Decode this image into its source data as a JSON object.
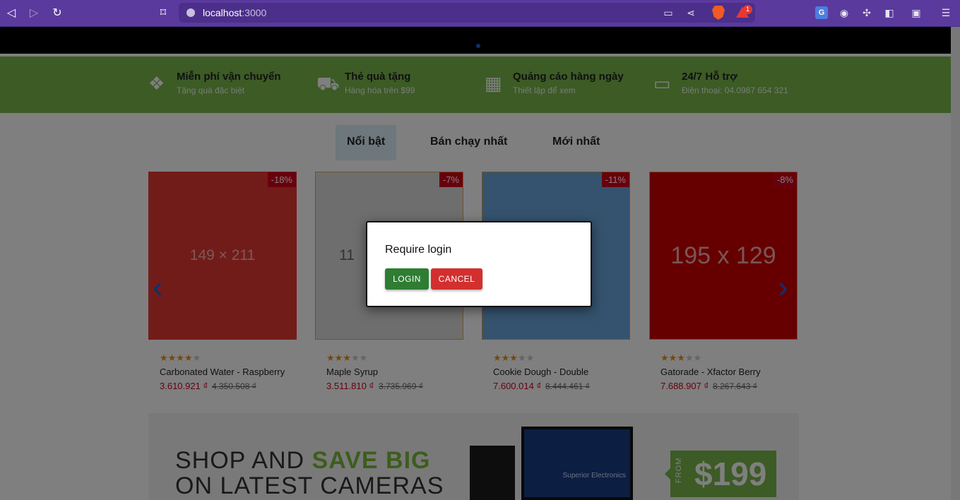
{
  "browser": {
    "url_host": "localhost",
    "url_port": ":3000",
    "rewards_badge": "1"
  },
  "features": [
    {
      "icon": "dropbox-icon",
      "title": "Miễn phí vận chuyển",
      "subtitle": "Tặng quà đặc biệt"
    },
    {
      "icon": "truck-icon",
      "title": "Thẻ quà tặng",
      "subtitle": "Hàng hóa trên $99"
    },
    {
      "icon": "calendar-icon",
      "title": "Quảng cáo hàng ngày",
      "subtitle": "Thiết lập để xem"
    },
    {
      "icon": "chat-icon",
      "title": "24/7 Hỗ trợ",
      "subtitle": "Điện thoại: 04.0987 654 321"
    }
  ],
  "tabs": [
    {
      "label": "Nổi bật",
      "active": true
    },
    {
      "label": "Bán chạy nhất",
      "active": false
    },
    {
      "label": "Mới nhất",
      "active": false
    }
  ],
  "products": [
    {
      "image_text": "149 × 211",
      "image_color": "#e53935",
      "discount": "-18%",
      "rating": 4,
      "name": "Carbonated Water - Raspberry",
      "price": "3.610.921 ₫",
      "old_price": "4.350.508 ₫"
    },
    {
      "image_text": "11",
      "image_color": "#dddddd",
      "discount": "-7%",
      "rating": 3,
      "name": "Maple Syrup",
      "price": "3.511.810 ₫",
      "old_price": "3.735.969 ₫"
    },
    {
      "image_text": "",
      "image_color": "#6aa6dc",
      "discount": "-11%",
      "rating": 3,
      "name": "Cookie Dough - Double",
      "price": "7.600.014 ₫",
      "old_price": "8.444.461 ₫"
    },
    {
      "image_text": "195 x 129",
      "image_color": "#cc0000",
      "discount": "-8%",
      "rating": 3,
      "name": "Gatorade - Xfactor Berry",
      "price": "7.688.907 ₫",
      "old_price": "8.267.643 ₫"
    }
  ],
  "banner": {
    "line1_prefix": "SHOP AND ",
    "line1_highlight": "SAVE BIG",
    "line2": "ON LATEST CAMERAS",
    "tv_text": "Superior Electronics",
    "from_label": "FROM",
    "price": "$199"
  },
  "modal": {
    "title": "Require login",
    "login_label": "LOGIN",
    "cancel_label": "CANCEL"
  },
  "colors": {
    "feature_bar": "#79b64a",
    "login": "#2e7d32",
    "cancel": "#d32f2f",
    "discount": "#d0021b"
  }
}
